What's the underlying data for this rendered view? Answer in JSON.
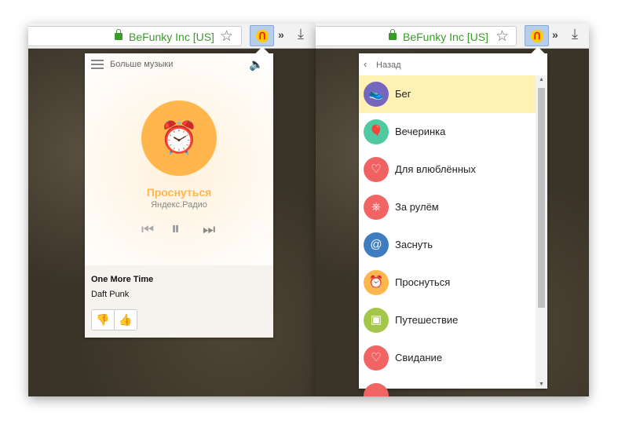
{
  "browser": {
    "site_label": "BeFunky Inc [US]",
    "extension_icon": "yandex-radio-headphones-icon"
  },
  "player": {
    "menu_label": "Больше музыки",
    "station_name": "Проснуться",
    "station_source": "Яндекс.Радио",
    "station_icon": "alarm-clock-icon",
    "track_title": "One More Time",
    "track_artist": "Daft Punk"
  },
  "stations": {
    "back_label": "Назад",
    "items": [
      {
        "label": "Бег",
        "color": "#7467c0",
        "icon": "sneaker-icon",
        "selected": true
      },
      {
        "label": "Вечеринка",
        "color": "#4fc9a0",
        "icon": "balloon-icon"
      },
      {
        "label": "Для влюблённых",
        "color": "#f06262",
        "icon": "heart-bird-icon"
      },
      {
        "label": "За рулём",
        "color": "#f26363",
        "icon": "steering-wheel-icon"
      },
      {
        "label": "Заснуть",
        "color": "#3d7dc0",
        "icon": "spiral-icon"
      },
      {
        "label": "Проснуться",
        "color": "#ffb74d",
        "icon": "alarm-clock-icon"
      },
      {
        "label": "Путешествие",
        "color": "#a4c74a",
        "icon": "backpack-icon"
      },
      {
        "label": "Свидание",
        "color": "#f06464",
        "icon": "hearts-icon"
      },
      {
        "label": "",
        "color": "#f06464",
        "icon": "partial-icon"
      }
    ]
  }
}
